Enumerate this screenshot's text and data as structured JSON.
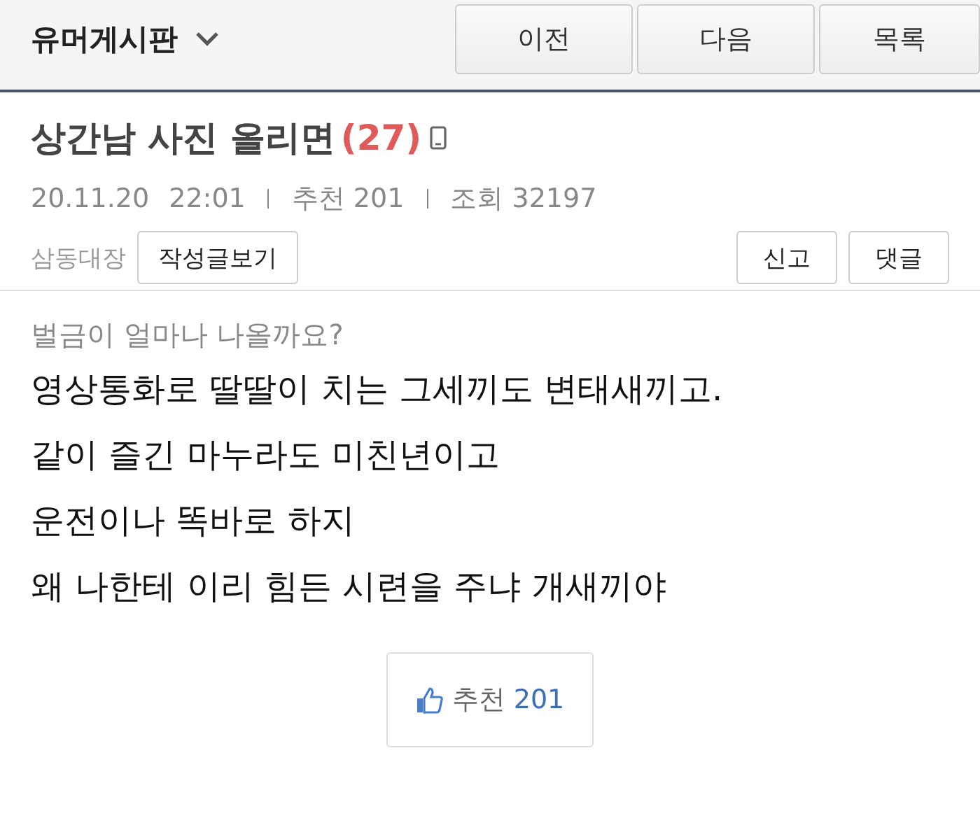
{
  "header": {
    "board": "유머게시판",
    "nav_buttons": [
      "이전",
      "다음",
      "목록"
    ]
  },
  "post": {
    "title": "상간남 사진 올리면",
    "comment_count": "(27)",
    "date": "20.11.20",
    "time": "22:01",
    "recommend": "추천 201",
    "views": "조회 32197",
    "author": "삼동대장",
    "author_posts_button": "작성글보기",
    "action_buttons": [
      "신고",
      "댓글"
    ]
  },
  "body": {
    "lead": "벌금이 얼마나 나올까요?",
    "lines": [
      "영상통화로 딸딸이 치는 그세끼도 변태새끼고.",
      "같이 즐긴 마누라도 미친년이고",
      "운전이나 똑바로 하지",
      "왜 나한테 이리 힘든 시련을 주냐 개새끼야"
    ]
  },
  "recommend_button": {
    "label": "추천",
    "count": "201"
  }
}
